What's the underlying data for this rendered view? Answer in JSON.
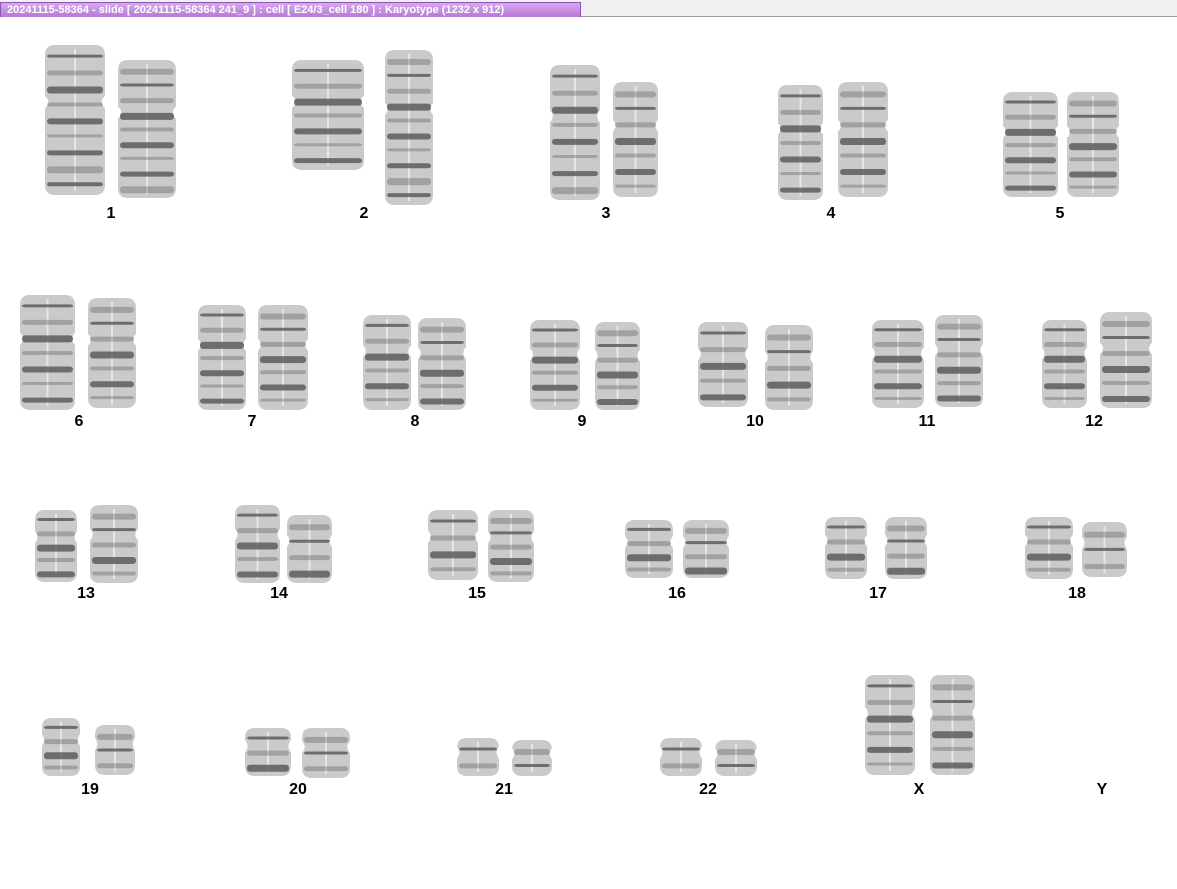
{
  "window": {
    "title": "20241115-58364 - slide [ 20241115-58364 241_9 ] : cell [ E24/3_cell 180 ] : Karyotype  (1232 x 912)"
  },
  "chromosome_color": "#555555",
  "chromosomes": [
    {
      "id": "1",
      "label": "1"
    },
    {
      "id": "2",
      "label": "2"
    },
    {
      "id": "3",
      "label": "3"
    },
    {
      "id": "4",
      "label": "4"
    },
    {
      "id": "5",
      "label": "5"
    },
    {
      "id": "6",
      "label": "6"
    },
    {
      "id": "7",
      "label": "7"
    },
    {
      "id": "8",
      "label": "8"
    },
    {
      "id": "9",
      "label": "9"
    },
    {
      "id": "10",
      "label": "10"
    },
    {
      "id": "11",
      "label": "11"
    },
    {
      "id": "12",
      "label": "12"
    },
    {
      "id": "13",
      "label": "13"
    },
    {
      "id": "14",
      "label": "14"
    },
    {
      "id": "15",
      "label": "15"
    },
    {
      "id": "16",
      "label": "16"
    },
    {
      "id": "17",
      "label": "17"
    },
    {
      "id": "18",
      "label": "18"
    },
    {
      "id": "19",
      "label": "19"
    },
    {
      "id": "20",
      "label": "20"
    },
    {
      "id": "21",
      "label": "21"
    },
    {
      "id": "22",
      "label": "22"
    },
    {
      "id": "X",
      "label": "X"
    },
    {
      "id": "Y",
      "label": "Y"
    }
  ]
}
